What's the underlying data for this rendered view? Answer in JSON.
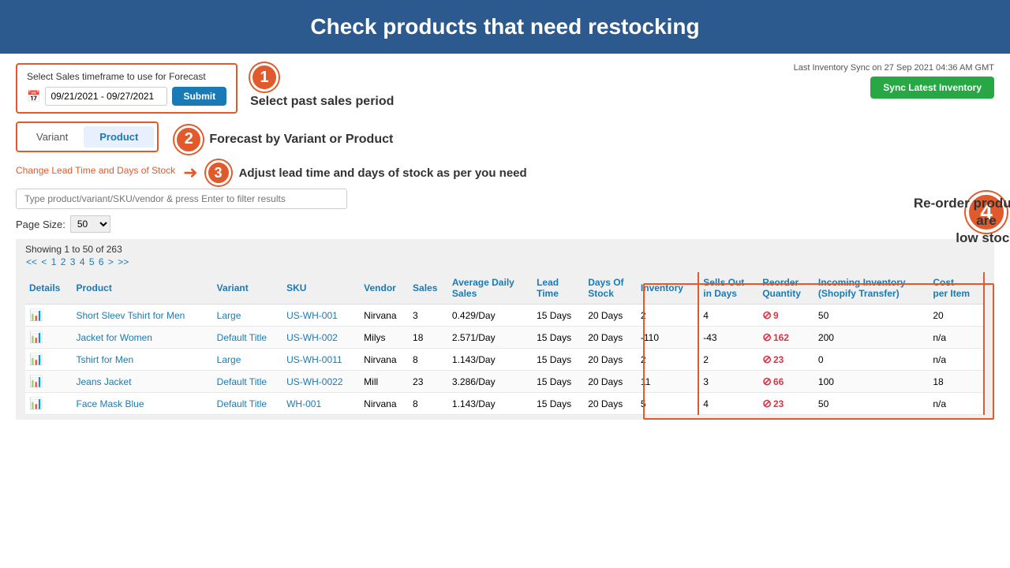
{
  "header": {
    "title": "Check products that need restocking"
  },
  "controls": {
    "forecast_label": "Select Sales timeframe to use for Forecast",
    "date_value": "09/21/2021 - 09/27/2021",
    "submit_label": "Submit",
    "sync_info": "Last Inventory Sync on 27 Sep 2021 04:36 AM GMT",
    "sync_label": "Sync Latest Inventory",
    "tab_variant": "Variant",
    "tab_product": "Product",
    "lead_time_link": "Change Lead Time and Days of Stock",
    "filter_placeholder": "Type product/variant/SKU/vendor & press Enter to filter results",
    "page_size_label": "Page Size:",
    "page_size_value": "50"
  },
  "annotations": {
    "bubble1": "1",
    "text1": "Select past sales period",
    "bubble2": "2",
    "text2": "Forecast  by Variant or Product",
    "bubble3": "3",
    "text3": "Adjust lead time and days of stock as per you need",
    "bubble4": "4",
    "text4_line1": "Re-order products that are",
    "text4_line2": "low stock"
  },
  "table": {
    "showing": "Showing 1 to 50 of 263",
    "pagination": "<< < 1 2 3 4 5 6 > >>",
    "columns": [
      "Details",
      "Product",
      "Variant",
      "SKU",
      "Vendor",
      "Sales",
      "Average Daily Sales",
      "Lead Time",
      "Days Of Stock",
      "Inventory",
      "Sells Out in Days",
      "Reorder Quantity",
      "Incoming Inventory (Shopify Transfer)",
      "Cost per Item"
    ],
    "rows": [
      {
        "details": "📊",
        "product": "Short Sleev Tshirt for Men",
        "variant": "Large",
        "sku": "US-WH-001",
        "vendor": "Nirvana",
        "sales": "3",
        "avg_daily": "0.429/Day",
        "lead_time": "15 Days",
        "days_stock": "20 Days",
        "inventory": "2",
        "sells_out": "4",
        "reorder_qty": "9",
        "incoming": "50",
        "cost": "20"
      },
      {
        "details": "📊",
        "product": "Jacket for Women",
        "variant": "Default Title",
        "sku": "US-WH-002",
        "vendor": "Milys",
        "sales": "18",
        "avg_daily": "2.571/Day",
        "lead_time": "15 Days",
        "days_stock": "20 Days",
        "inventory": "-110",
        "sells_out": "-43",
        "reorder_qty": "162",
        "incoming": "200",
        "cost": "n/a"
      },
      {
        "details": "📊",
        "product": "Tshirt for Men",
        "variant": "Large",
        "sku": "US-WH-0011",
        "vendor": "Nirvana",
        "sales": "8",
        "avg_daily": "1.143/Day",
        "lead_time": "15 Days",
        "days_stock": "20 Days",
        "inventory": "2",
        "sells_out": "2",
        "reorder_qty": "23",
        "incoming": "0",
        "cost": "n/a"
      },
      {
        "details": "📊",
        "product": "Jeans Jacket",
        "variant": "Default Title",
        "sku": "US-WH-0022",
        "vendor": "Mill",
        "sales": "23",
        "avg_daily": "3.286/Day",
        "lead_time": "15 Days",
        "days_stock": "20 Days",
        "inventory": "11",
        "sells_out": "3",
        "reorder_qty": "66",
        "incoming": "100",
        "cost": "18"
      },
      {
        "details": "📊",
        "product": "Face Mask Blue",
        "variant": "Default Title",
        "sku": "WH-001",
        "vendor": "Nirvana",
        "sales": "8",
        "avg_daily": "1.143/Day",
        "lead_time": "15 Days",
        "days_stock": "20 Days",
        "inventory": "5",
        "sells_out": "4",
        "reorder_qty": "23",
        "incoming": "50",
        "cost": "n/a"
      }
    ]
  }
}
